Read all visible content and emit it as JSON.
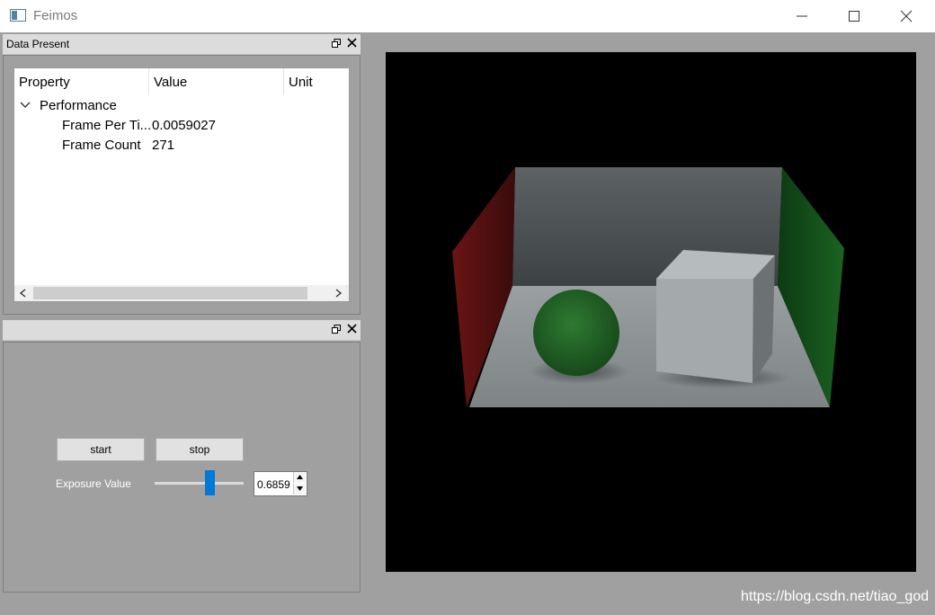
{
  "window": {
    "title": "Feimos"
  },
  "data_dock": {
    "title": "Data Present",
    "columns": [
      "Property",
      "Value",
      "Unit"
    ],
    "group": {
      "label": "Performance"
    },
    "rows": [
      {
        "property": "Frame Per Ti...",
        "value": "0.0059027"
      },
      {
        "property": "Frame Count",
        "value": "271"
      }
    ]
  },
  "control_dock": {
    "start_label": "start",
    "stop_label": "stop",
    "exposure_label": "Exposure Value",
    "exposure_value": "0.6859",
    "slider_level": 0.64
  },
  "watermark": "https://blog.csdn.net/tiao_god"
}
